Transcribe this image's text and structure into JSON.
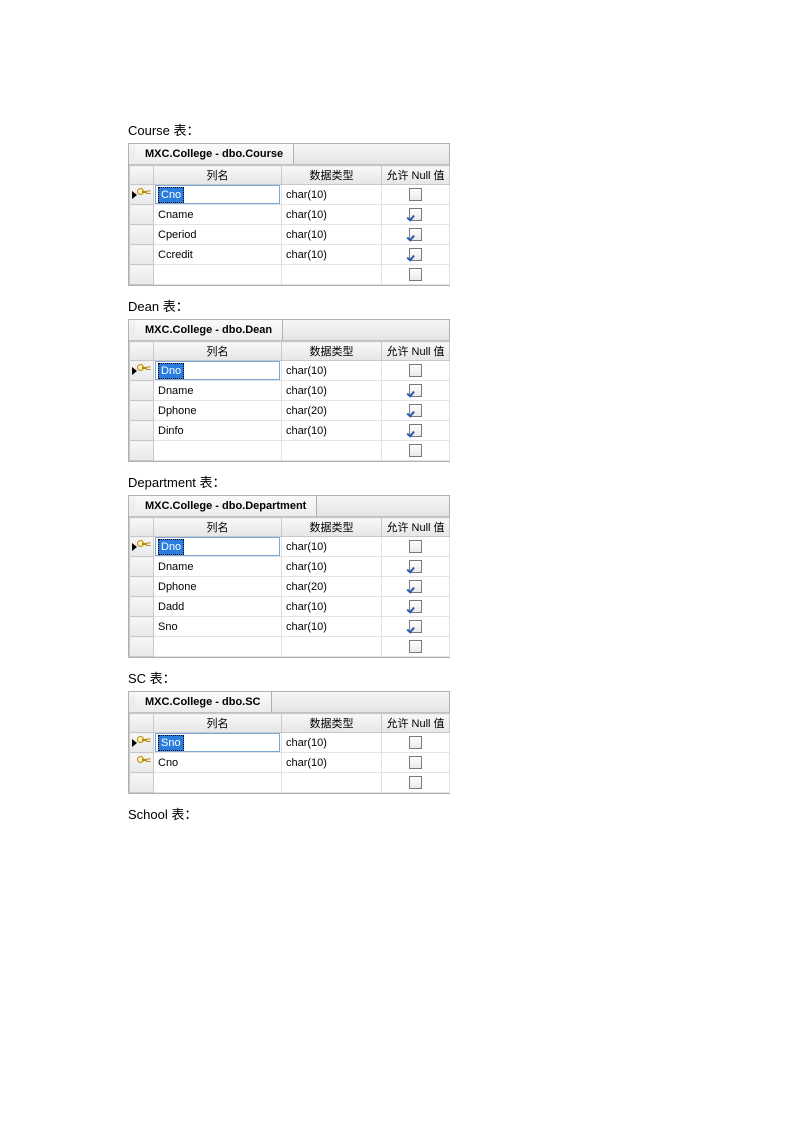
{
  "headers": {
    "name": "列名",
    "type": "数据类型",
    "null": "允许 Null 值"
  },
  "sections": [
    {
      "label": "Course 表：",
      "tab": "MXC.College - dbo.Course",
      "rows": [
        {
          "name": "Cno",
          "type": "char(10)",
          "null": false,
          "pk": true,
          "active": true,
          "selected": true
        },
        {
          "name": "Cname",
          "type": "char(10)",
          "null": true
        },
        {
          "name": "Cperiod",
          "type": "char(10)",
          "null": true
        },
        {
          "name": "Ccredit",
          "type": "char(10)",
          "null": true
        }
      ]
    },
    {
      "label": "Dean 表：",
      "tab": "MXC.College - dbo.Dean",
      "rows": [
        {
          "name": "Dno",
          "type": "char(10)",
          "null": false,
          "pk": true,
          "active": true,
          "selected": true
        },
        {
          "name": "Dname",
          "type": "char(10)",
          "null": true
        },
        {
          "name": "Dphone",
          "type": "char(20)",
          "null": true
        },
        {
          "name": "Dinfo",
          "type": "char(10)",
          "null": true
        }
      ]
    },
    {
      "label": "Department 表：",
      "tab": "MXC.College - dbo.Department",
      "rows": [
        {
          "name": "Dno",
          "type": "char(10)",
          "null": false,
          "pk": true,
          "active": true,
          "selected": true
        },
        {
          "name": "Dname",
          "type": "char(10)",
          "null": true
        },
        {
          "name": "Dphone",
          "type": "char(20)",
          "null": true
        },
        {
          "name": "Dadd",
          "type": "char(10)",
          "null": true
        },
        {
          "name": "Sno",
          "type": "char(10)",
          "null": true
        }
      ]
    },
    {
      "label": "SC 表：",
      "tab": "MXC.College - dbo.SC",
      "rows": [
        {
          "name": "Sno",
          "type": "char(10)",
          "null": false,
          "pk": true,
          "active": true,
          "selected": true
        },
        {
          "name": "Cno",
          "type": "char(10)",
          "null": false,
          "pk": true
        }
      ]
    },
    {
      "label": "School 表："
    }
  ]
}
